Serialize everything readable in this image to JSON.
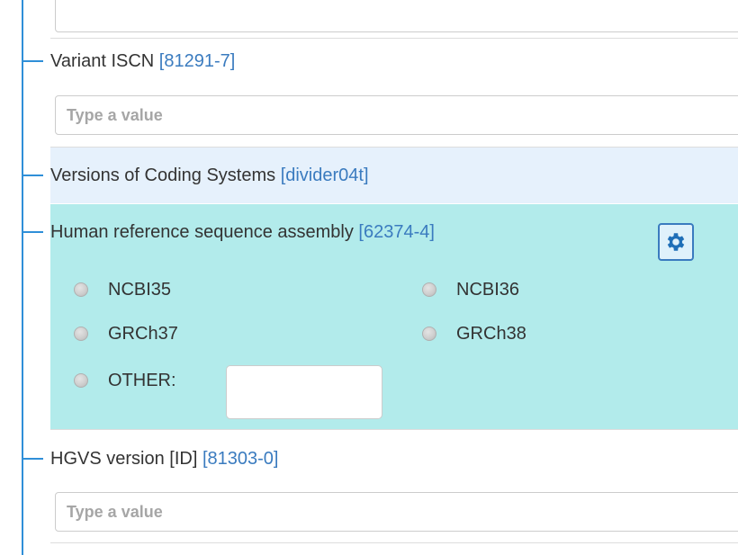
{
  "fields": {
    "variant_iscn": {
      "label": "Variant ISCN",
      "code": "[81291-7]",
      "placeholder": "Type a value"
    },
    "versions_divider": {
      "label": "Versions of Coding Systems",
      "code": "[divider04t]"
    },
    "reference_assembly": {
      "label": "Human reference sequence assembly",
      "code": "[62374-4]",
      "settings_icon": "gear-icon",
      "options": [
        "NCBI35",
        "NCBI36",
        "GRCh37",
        "GRCh38",
        "OTHER:"
      ],
      "other_value": ""
    },
    "hgvs_version": {
      "label": "HGVS version [ID]",
      "code": "[81303-0]",
      "placeholder": "Type a value"
    }
  },
  "colors": {
    "tree_line": "#2f8fd8",
    "code_text": "#3a7bbf",
    "divider_background": "#e6f1fc",
    "section_background": "#b2ebeb"
  }
}
